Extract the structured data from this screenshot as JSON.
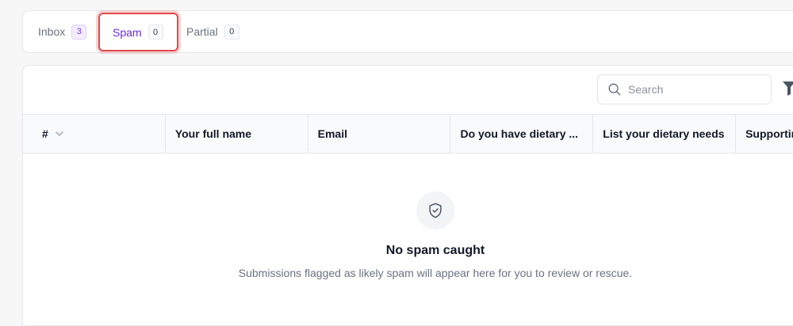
{
  "tabs": [
    {
      "label": "Inbox",
      "count": "3"
    },
    {
      "label": "Spam",
      "count": "0",
      "active": true
    },
    {
      "label": "Partial",
      "count": "0"
    }
  ],
  "toolbar": {
    "search_placeholder": "Search",
    "search_icon": "search-icon",
    "filter_icon": "filter-icon"
  },
  "table": {
    "columns": [
      "#",
      "Your full name",
      "Email",
      "Do you have dietary ...",
      "List your dietary needs",
      "Supporting"
    ]
  },
  "empty_state": {
    "icon": "shield-check-icon",
    "title": "No spam caught",
    "description": "Submissions flagged as likely spam will appear here for you to review or rescue."
  },
  "colors": {
    "accent": "#6d28d9",
    "highlight": "#e14a4a"
  }
}
